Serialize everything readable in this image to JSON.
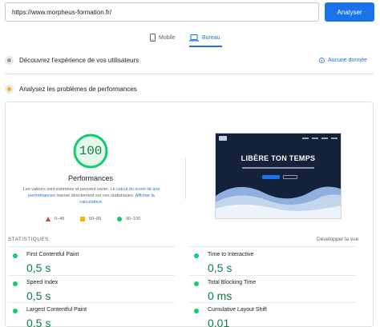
{
  "search": {
    "url": "https://www.morpheus-formation.fr/",
    "button_label": "Analyser"
  },
  "tabs": {
    "mobile_label": "Mobile",
    "desktop_label": "Bureau"
  },
  "field_data": {
    "title": "Découvrez l'expérience de vos utilisateurs",
    "no_data_label": "Aucune donnée"
  },
  "lab_section": {
    "title": "Analysez les problèmes de performances"
  },
  "score": {
    "value": "100",
    "label": "Performances",
    "desc_before": "Les valeurs sont estimées et peuvent varier. Le ",
    "desc_link1": "calcul du score lié aux performances",
    "desc_middle": " repose directement sur ces statistiques. ",
    "desc_link2": "Afficher la calculatrice.",
    "desc_after": ""
  },
  "legend": {
    "fail": "0–49",
    "average": "50–89",
    "pass": "90–100"
  },
  "preview": {
    "headline": "LIBÈRE TON TEMPS"
  },
  "metrics_header": {
    "label": "STATISTIQUES",
    "expand": "Développer la vue"
  },
  "metrics": [
    {
      "name": "First Contentful Paint",
      "value": "0,5 s"
    },
    {
      "name": "Time to Interactive",
      "value": "0,5 s"
    },
    {
      "name": "Speed Index",
      "value": "0,5 s"
    },
    {
      "name": "Total Blocking Time",
      "value": "0 ms"
    },
    {
      "name": "Largest Contentful Paint",
      "value": "0,5 s"
    },
    {
      "name": "Cumulative Layout Shift",
      "value": "0,01"
    }
  ],
  "colors": {
    "accent": "#1a73e8",
    "pass": "#0cce6b",
    "pass_text": "#0d8043",
    "average": "#f4b400",
    "fail": "#e53935"
  }
}
